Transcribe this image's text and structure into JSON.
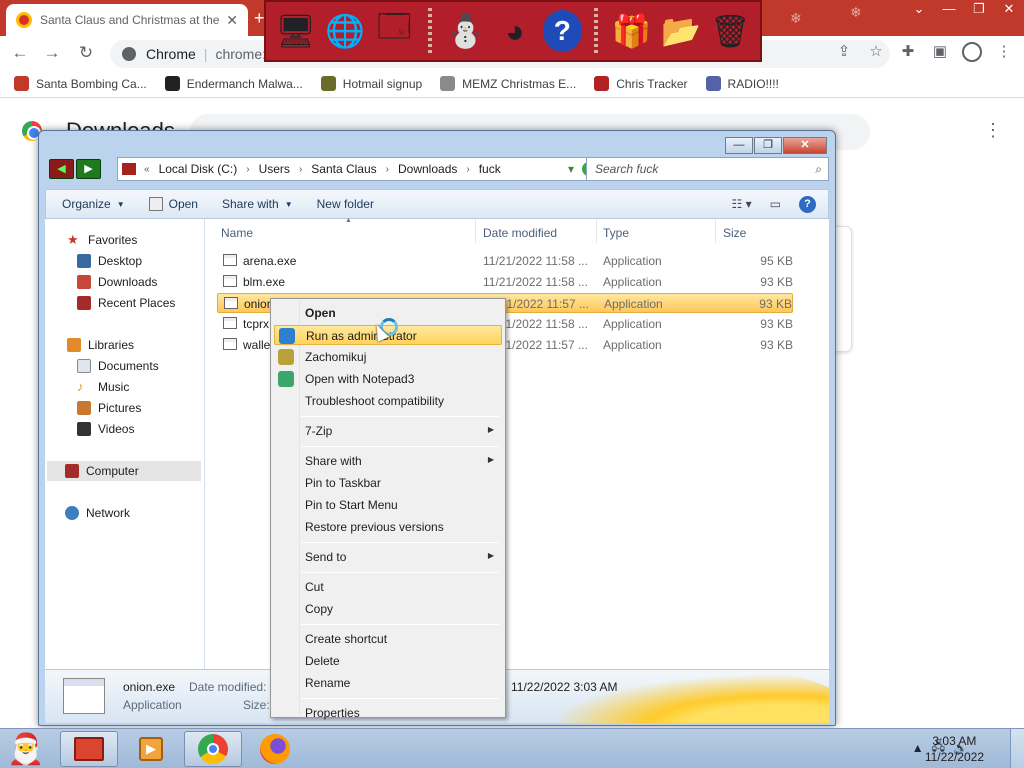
{
  "browser": {
    "tab_title": "Santa Claus and Christmas at the",
    "tab_close": "✕",
    "new_tab": "+",
    "omnibox_label": "Chrome",
    "omnibox_url": "chrome://",
    "window_controls": [
      "⌄",
      "—",
      "❐",
      "✕"
    ]
  },
  "bookmarks": [
    {
      "label": "Santa Bombing Ca...",
      "icon": "santa-icon",
      "color": "#c0392b"
    },
    {
      "label": "Endermanch Malwa...",
      "icon": "enderman-icon",
      "color": "#222222"
    },
    {
      "label": "Hotmail signup",
      "icon": "trophy-icon",
      "color": "#6b6b2a"
    },
    {
      "label": "MEMZ Christmas E...",
      "icon": "memz-icon",
      "color": "#8a8a8a"
    },
    {
      "label": "Chris Tracker",
      "icon": "chris-tracker-icon",
      "color": "#b22222"
    },
    {
      "label": "RADIO!!!!",
      "icon": "radio-icon",
      "color": "#5561a8"
    }
  ],
  "downloads_page": {
    "title": "Downloads"
  },
  "explorer": {
    "caption_buttons": [
      "—",
      "❐",
      "✕"
    ],
    "breadcrumb": [
      "Local Disk (C:)",
      "Users",
      "Santa Claus",
      "Downloads",
      "fuck"
    ],
    "search_placeholder": "Search fuck",
    "commands": [
      {
        "label": "Organize",
        "has_dropdown": true
      },
      {
        "label": "Open",
        "has_dropdown": false
      },
      {
        "label": "Share with",
        "has_dropdown": true
      },
      {
        "label": "New folder",
        "has_dropdown": false
      }
    ],
    "nav": {
      "favorites": "Favorites",
      "favorite_items": [
        "Desktop",
        "Downloads",
        "Recent Places"
      ],
      "libraries": "Libraries",
      "library_items": [
        "Documents",
        "Music",
        "Pictures",
        "Videos"
      ],
      "computer": "Computer",
      "network": "Network"
    },
    "columns": [
      "Name",
      "Date modified",
      "Type",
      "Size"
    ],
    "files": [
      {
        "name": "arena.exe",
        "date": "11/21/2022 11:58 ...",
        "type": "Application",
        "size": "95 KB",
        "selected": false
      },
      {
        "name": "blm.exe",
        "date": "11/21/2022 11:58 ...",
        "type": "Application",
        "size": "93 KB",
        "selected": false
      },
      {
        "name": "onion.exe",
        "date": "11/21/2022 11:57 ...",
        "type": "Application",
        "size": "93 KB",
        "selected": true
      },
      {
        "name": "tcprx.exe",
        "date": "11/21/2022 11:58 ...",
        "type": "Application",
        "size": "93 KB",
        "selected": false
      },
      {
        "name": "wallet.exe",
        "date": "11/21/2022 11:57 ...",
        "type": "Application",
        "size": "93 KB",
        "selected": false
      }
    ],
    "details": {
      "file_name": "onion.exe",
      "file_type": "Application",
      "date_label": "Date modified:",
      "size_label": "Size:",
      "date_value": "11/22/2022 3:03 AM"
    }
  },
  "context_menu": {
    "items": [
      {
        "label": "Open",
        "bold": true,
        "submenu": false,
        "icon": ""
      },
      {
        "label": "Run as administrator",
        "bold": false,
        "submenu": false,
        "icon": "uac-shield-icon",
        "highlighted": true
      },
      {
        "label": "Zachomikuj",
        "bold": false,
        "submenu": false,
        "icon": "chomikuj-icon"
      },
      {
        "label": "Open with Notepad3",
        "bold": false,
        "submenu": false,
        "icon": "notepad3-icon"
      },
      {
        "label": "Troubleshoot compatibility",
        "bold": false,
        "submenu": false,
        "icon": ""
      },
      {
        "label": "7-Zip",
        "bold": false,
        "submenu": true,
        "icon": ""
      },
      {
        "label": "Share with",
        "bold": false,
        "submenu": true,
        "icon": ""
      },
      {
        "label": "Pin to Taskbar",
        "bold": false,
        "submenu": false,
        "icon": ""
      },
      {
        "label": "Pin to Start Menu",
        "bold": false,
        "submenu": false,
        "icon": ""
      },
      {
        "label": "Restore previous versions",
        "bold": false,
        "submenu": false,
        "icon": ""
      },
      {
        "label": "Send to",
        "bold": false,
        "submenu": true,
        "icon": ""
      },
      {
        "label": "Cut",
        "bold": false,
        "submenu": false,
        "icon": ""
      },
      {
        "label": "Copy",
        "bold": false,
        "submenu": false,
        "icon": ""
      },
      {
        "label": "Create shortcut",
        "bold": false,
        "submenu": false,
        "icon": ""
      },
      {
        "label": "Delete",
        "bold": false,
        "submenu": false,
        "icon": ""
      },
      {
        "label": "Rename",
        "bold": false,
        "submenu": false,
        "icon": ""
      },
      {
        "label": "Properties",
        "bold": false,
        "submenu": false,
        "icon": ""
      }
    ]
  },
  "taskbar": {
    "start_icon": "santa-start-icon",
    "buttons": [
      "explorer-icon",
      "media-player-icon",
      "chrome-icon",
      "firefox-icon"
    ],
    "active_buttons": [
      "explorer-icon",
      "chrome-icon"
    ],
    "time": "3:03 AM",
    "date": "11/22/2022"
  },
  "colors": {
    "tabstrip": "#c0392b",
    "selection": "#ffc85a",
    "taskbar": "#b8cde4"
  }
}
